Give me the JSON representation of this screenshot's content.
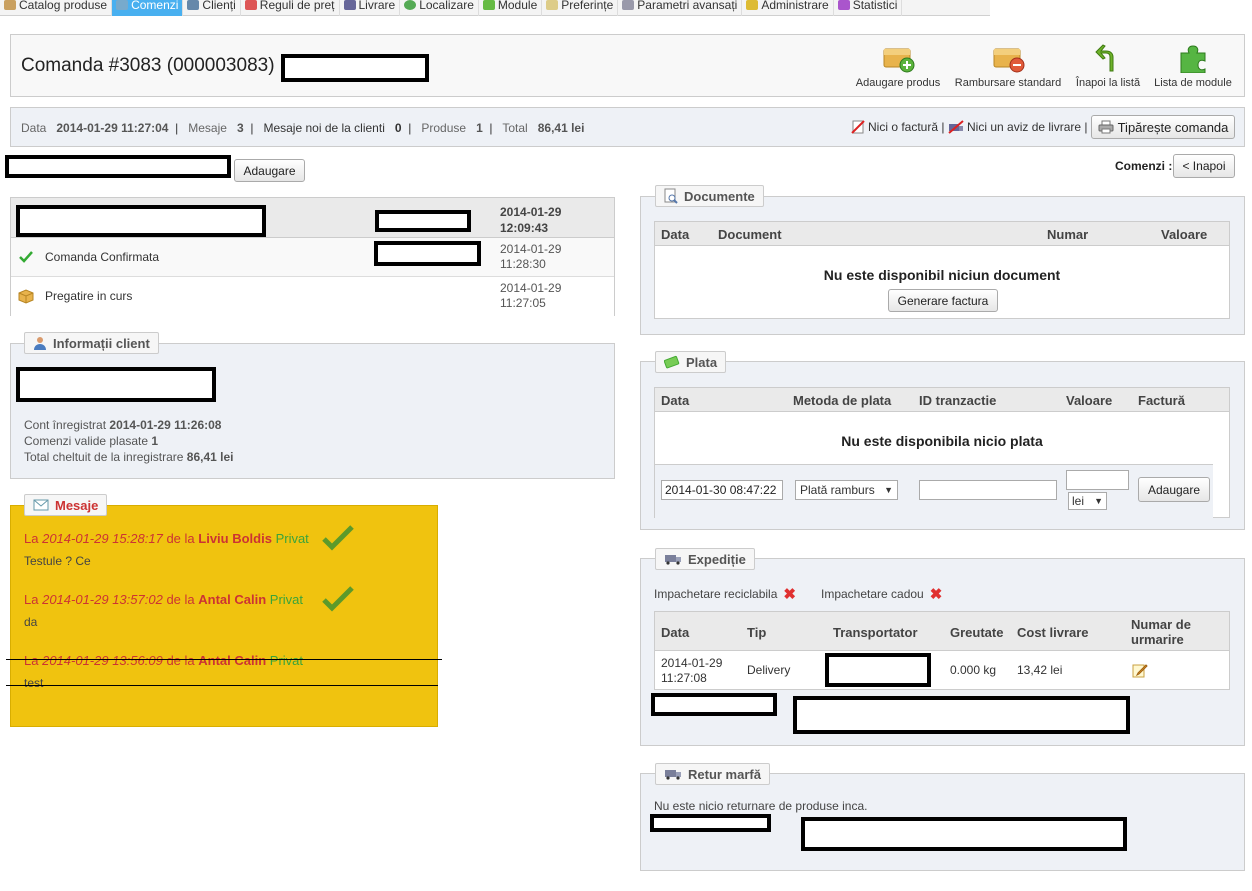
{
  "nav": {
    "tabs": [
      "Catalog produse",
      "Comenzi",
      "Clienți",
      "Reguli de preț",
      "Livrare",
      "Localizare",
      "Module",
      "Preferințe",
      "Parametri avansați",
      "Administrare",
      "Statistici"
    ]
  },
  "header": {
    "title": "Comanda #3083 (000003083)",
    "actions": [
      "Adaugare produs",
      "Rambursare standard",
      "Înapoi la listă",
      "Lista de module"
    ]
  },
  "summary": {
    "data_label": "Data",
    "data_value": "2014-01-29 11:27:04",
    "mesaje_label": "Mesaje",
    "mesaje_value": "3",
    "noi_label": "Mesaje noi de la clienti",
    "noi_value": "0",
    "produse_label": "Produse",
    "produse_value": "1",
    "total_label": "Total",
    "total_value": "86,41 lei",
    "nici_factura": "Nici o factură |",
    "nici_aviz": "Nici un aviz de livrare |",
    "print_label": "Tipărește comanda"
  },
  "add_button": "Adaugare",
  "comenzi_label": "Comenzi :",
  "inapoi_label": "< Inapoi",
  "status": {
    "head_date": "2014-01-29",
    "head_time": "12:09:43",
    "rows": [
      {
        "label": "Comanda Confirmata",
        "date": "2014-01-29",
        "time": "11:28:30"
      },
      {
        "label": "Pregatire in curs",
        "date": "2014-01-29",
        "time": "11:27:05"
      }
    ]
  },
  "client": {
    "legend": "Informații client",
    "cont_label": "Cont înregistrat",
    "cont_value": "2014-01-29 11:26:08",
    "valide_label": "Comenzi valide plasate",
    "valide_value": "1",
    "total_label": "Total cheltuit de la inregistrare",
    "total_value": "86,41 lei"
  },
  "messages": {
    "legend": "Mesaje",
    "items": [
      {
        "prefix": "La",
        "date": "2014-01-29 15:28:17",
        "by": "de la",
        "author": "Liviu Boldis",
        "tag": "Privat",
        "text": "Testule ? Ce"
      },
      {
        "prefix": "La",
        "date": "2014-01-29 13:57:02",
        "by": "de la",
        "author": "Antal Calin",
        "tag": "Privat",
        "text": "da"
      },
      {
        "prefix": "La",
        "date": "2014-01-29 13:56:09",
        "by": "de la",
        "author": "Antal Calin",
        "tag": "Privat",
        "text": "test"
      }
    ]
  },
  "documents": {
    "legend": "Documente",
    "cols": [
      "Data",
      "Document",
      "Numar",
      "Valoare"
    ],
    "empty": "Nu este disponibil niciun document",
    "button": "Generare factura"
  },
  "payment": {
    "legend": "Plata",
    "cols": [
      "Data",
      "Metoda de plata",
      "ID tranzactie",
      "Valoare",
      "Factură"
    ],
    "empty": "Nu este disponibila nicio plata",
    "date_value": "2014-01-30 08:47:22",
    "method_value": "Plată ramburs",
    "currency": "lei",
    "button": "Adaugare"
  },
  "shipping": {
    "legend": "Expediție",
    "reciclabila": "Impachetare reciclabila",
    "cadou": "Impachetare cadou",
    "cols": [
      "Data",
      "Tip",
      "Transportator",
      "Greutate",
      "Cost livrare",
      "Numar de urmarire"
    ],
    "row": {
      "date": "2014-01-29",
      "time": "11:27:08",
      "tip": "Delivery",
      "greutate": "0.000 kg",
      "cost": "13,42 lei"
    }
  },
  "returns": {
    "legend": "Retur marfă",
    "empty": "Nu este nicio returnare de produse inca."
  },
  "colors": {
    "accent": "#49b0f0",
    "messages_bg": "#f0c30f",
    "red": "#cc3333",
    "green": "#3aa43a"
  }
}
